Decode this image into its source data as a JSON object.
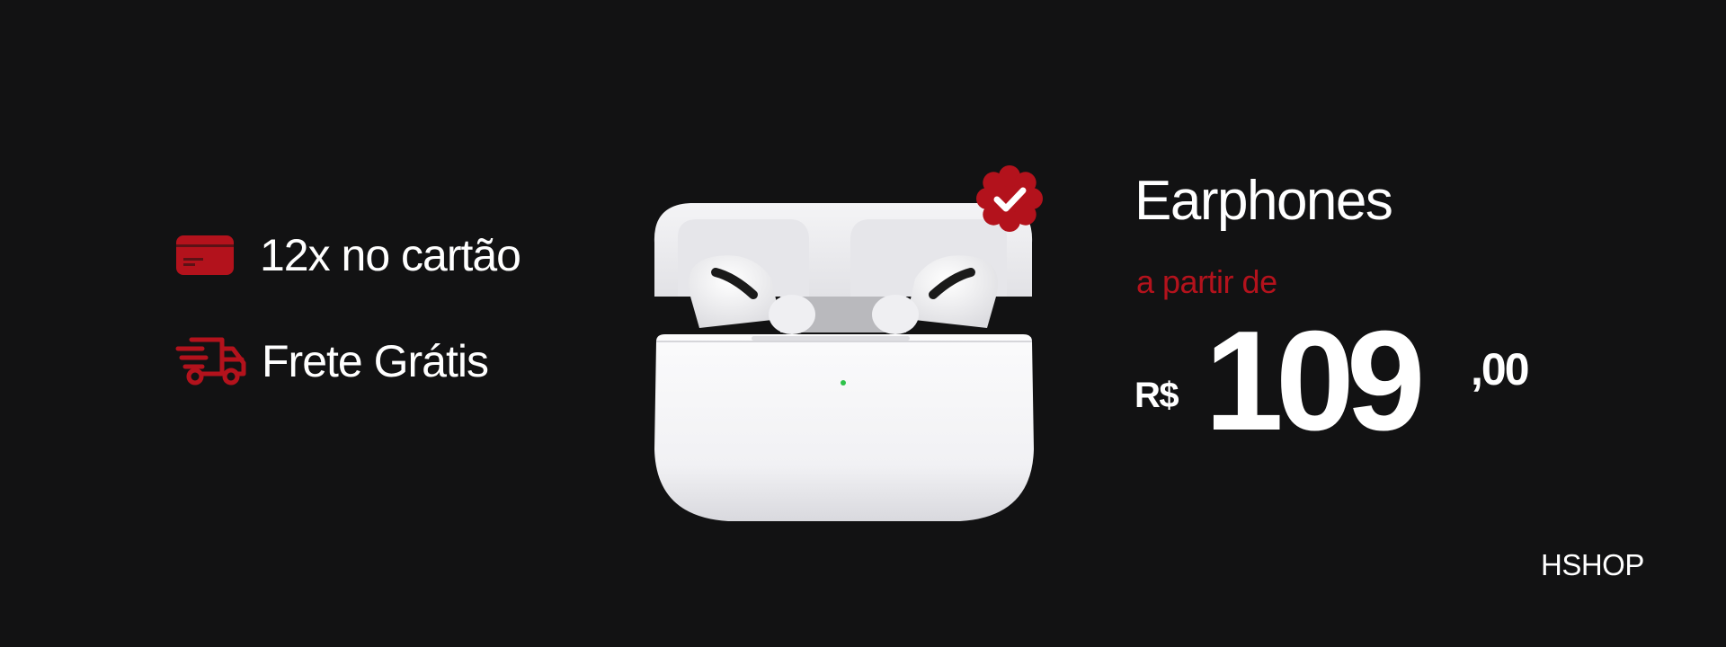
{
  "features": [
    {
      "icon": "credit-card-icon",
      "label": "12x no cartão"
    },
    {
      "icon": "delivery-truck-icon",
      "label": "Frete Grátis"
    }
  ],
  "product": {
    "image": "earphones-case-image",
    "badge_icon": "verified-check-icon",
    "title": "Earphones",
    "from_label": "a partir de",
    "currency": "R$",
    "price_integer": "109",
    "price_cents": ",00"
  },
  "brand": "HSHOP",
  "colors": {
    "background": "#121213",
    "accent": "#b3121c",
    "text": "#ffffff"
  }
}
